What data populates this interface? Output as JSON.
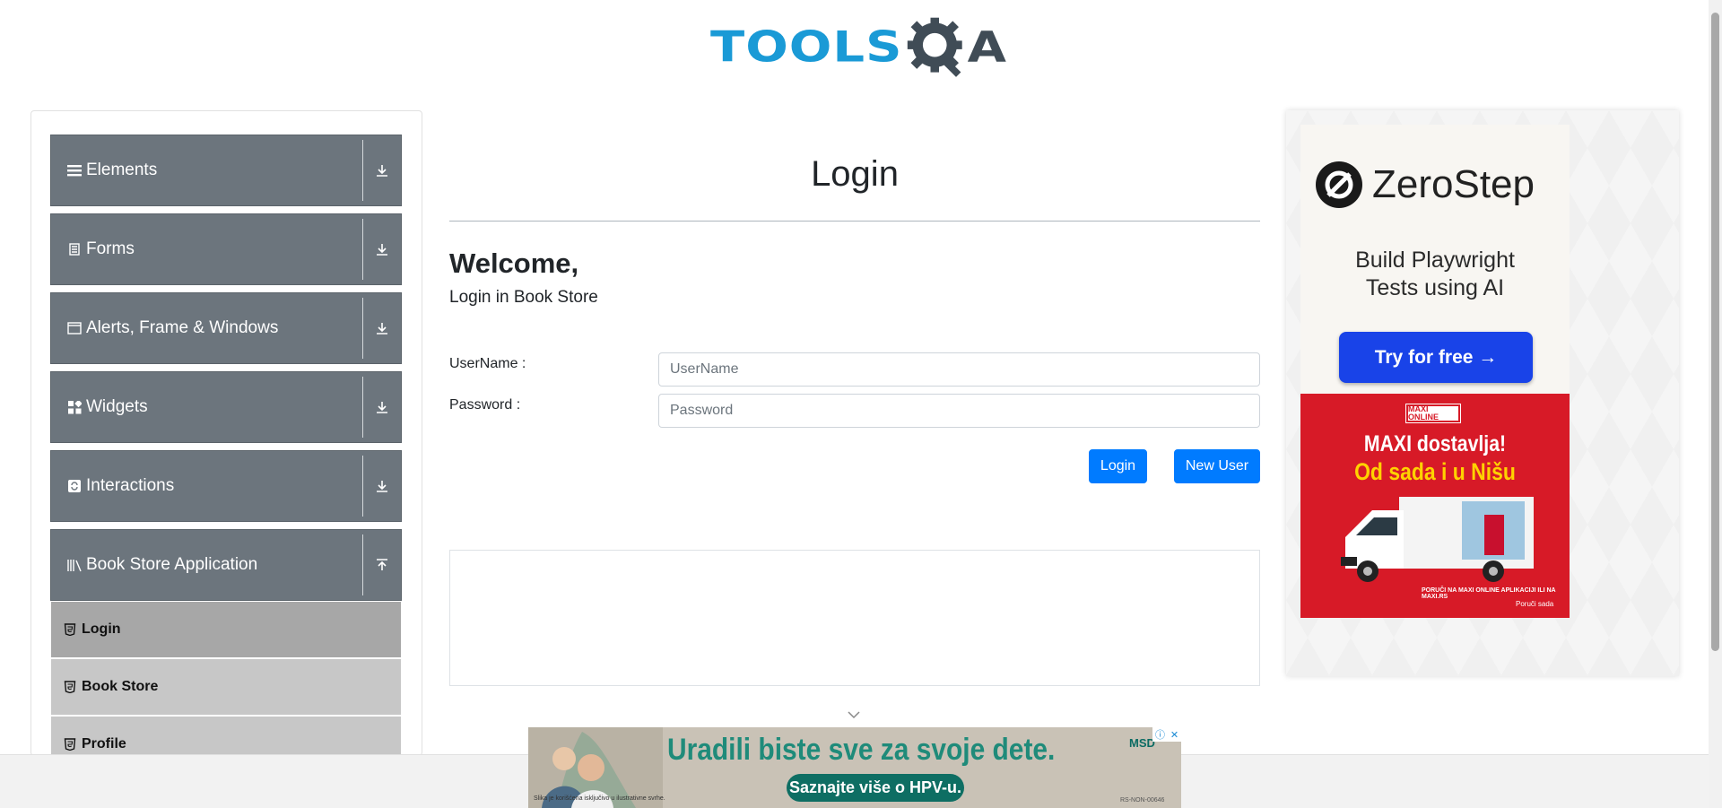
{
  "header": {
    "logo_text_left": "TOOLS",
    "logo_text_right": "A"
  },
  "sidebar": {
    "groups": [
      {
        "label": "Elements",
        "icon": "list-icon",
        "state": "collapsed"
      },
      {
        "label": "Forms",
        "icon": "form-icon",
        "state": "collapsed"
      },
      {
        "label": "Alerts, Frame & Windows",
        "icon": "window-icon",
        "state": "collapsed"
      },
      {
        "label": "Widgets",
        "icon": "widgets-icon",
        "state": "collapsed"
      },
      {
        "label": "Interactions",
        "icon": "interactions-icon",
        "state": "collapsed"
      },
      {
        "label": "Book Store Application",
        "icon": "books-icon",
        "state": "expanded"
      }
    ],
    "book_store_items": [
      {
        "label": "Login",
        "active": true
      },
      {
        "label": "Book Store",
        "active": false
      },
      {
        "label": "Profile",
        "active": false
      }
    ]
  },
  "main": {
    "title": "Login",
    "welcome": "Welcome,",
    "subtitle": "Login in Book Store",
    "username_label": "UserName :",
    "username_placeholder": "UserName",
    "username_value": "",
    "password_label": "Password :",
    "password_placeholder": "Password",
    "password_value": "",
    "login_button": "Login",
    "new_user_button": "New User"
  },
  "right_ad": {
    "brand": "ZeroStep",
    "tagline_line1": "Build Playwright",
    "tagline_line2": "Tests using AI",
    "cta": "Try for free →",
    "maxi_badge": "MAXI ONLINE",
    "maxi_headline": "MAXI dostavlja!",
    "maxi_subheadline": "Od sada i u Nišu",
    "maxi_small": "PORUČI NA MAXI ONLINE APLIKACIJI ILI NA MAXI.RS",
    "maxi_cta": "Poruči sada"
  },
  "bottom_ad": {
    "headline": "Uradili biste sve za svoje dete.",
    "cta": "Saznajte više o HPV-u.",
    "brand": "MSD",
    "small_text": "Slika je korišćena isključivo u ilustrativne svrhe.",
    "code": "RS-NON-00646"
  },
  "colors": {
    "nav_group_bg": "#6c757d",
    "nav_sub_active": "#a7a7a7",
    "nav_sub_bg": "#c7c7c7",
    "primary": "#007bff",
    "logo_blue": "#1a9ad6"
  }
}
